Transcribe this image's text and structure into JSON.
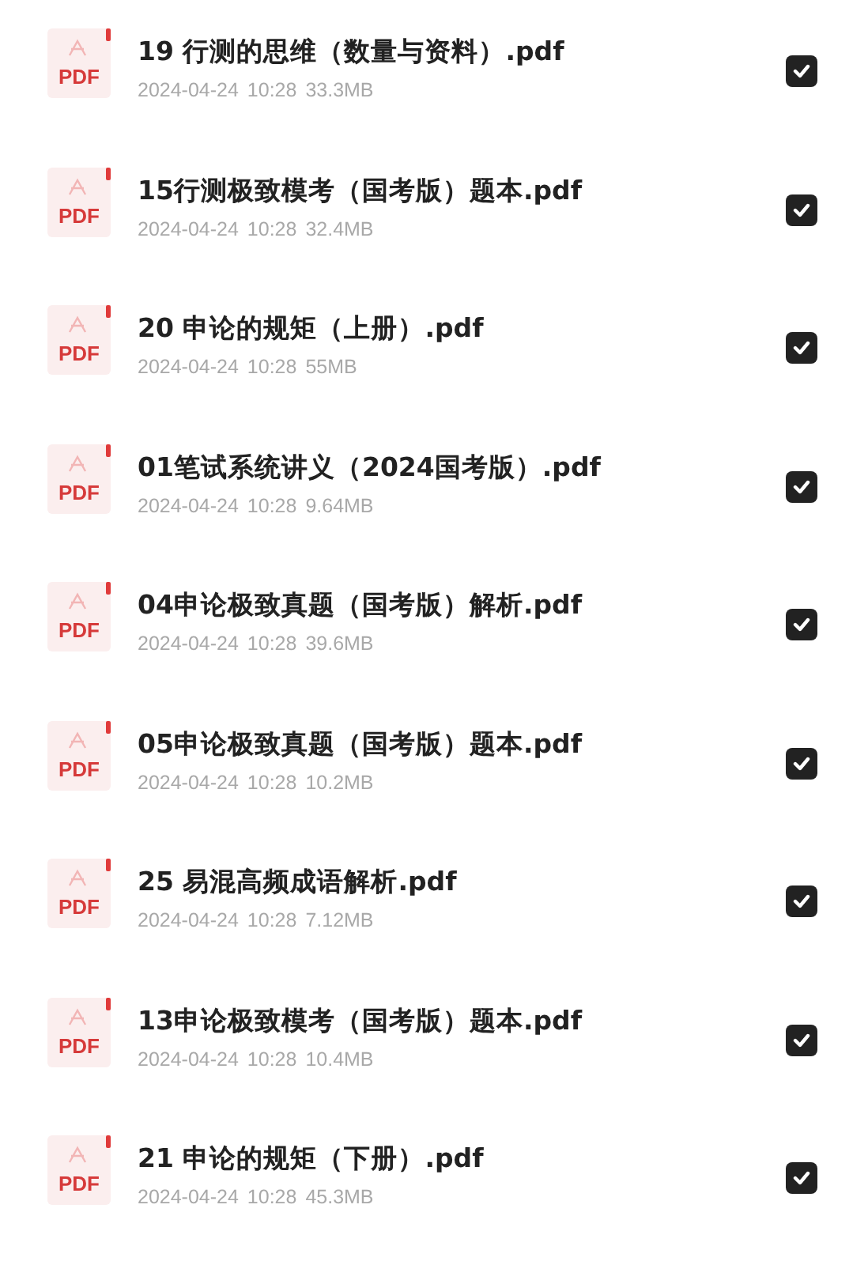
{
  "files": [
    {
      "icon_label": "PDF",
      "name": "19 行测的思维（数量与资料）.pdf",
      "date": "2024-04-24 10:28",
      "size": "33.3MB",
      "checked": true
    },
    {
      "icon_label": "PDF",
      "name": "15行测极致模考（国考版）题本.pdf",
      "date": "2024-04-24 10:28",
      "size": "32.4MB",
      "checked": true
    },
    {
      "icon_label": "PDF",
      "name": "20 申论的规矩（上册）.pdf",
      "date": "2024-04-24 10:28",
      "size": "55MB",
      "checked": true
    },
    {
      "icon_label": "PDF",
      "name": "01笔试系统讲义（2024国考版）.pdf",
      "date": "2024-04-24 10:28",
      "size": "9.64MB",
      "checked": true
    },
    {
      "icon_label": "PDF",
      "name": "04申论极致真题（国考版）解析.pdf",
      "date": "2024-04-24 10:28",
      "size": "39.6MB",
      "checked": true
    },
    {
      "icon_label": "PDF",
      "name": "05申论极致真题（国考版）题本.pdf",
      "date": "2024-04-24 10:28",
      "size": "10.2MB",
      "checked": true
    },
    {
      "icon_label": "PDF",
      "name": "25 易混高频成语解析.pdf",
      "date": "2024-04-24 10:28",
      "size": "7.12MB",
      "checked": true
    },
    {
      "icon_label": "PDF",
      "name": "13申论极致模考（国考版）题本.pdf",
      "date": "2024-04-24 10:28",
      "size": "10.4MB",
      "checked": true
    },
    {
      "icon_label": "PDF",
      "name": "21 申论的规矩（下册）.pdf",
      "date": "2024-04-24 10:28",
      "size": "45.3MB",
      "checked": true
    }
  ]
}
